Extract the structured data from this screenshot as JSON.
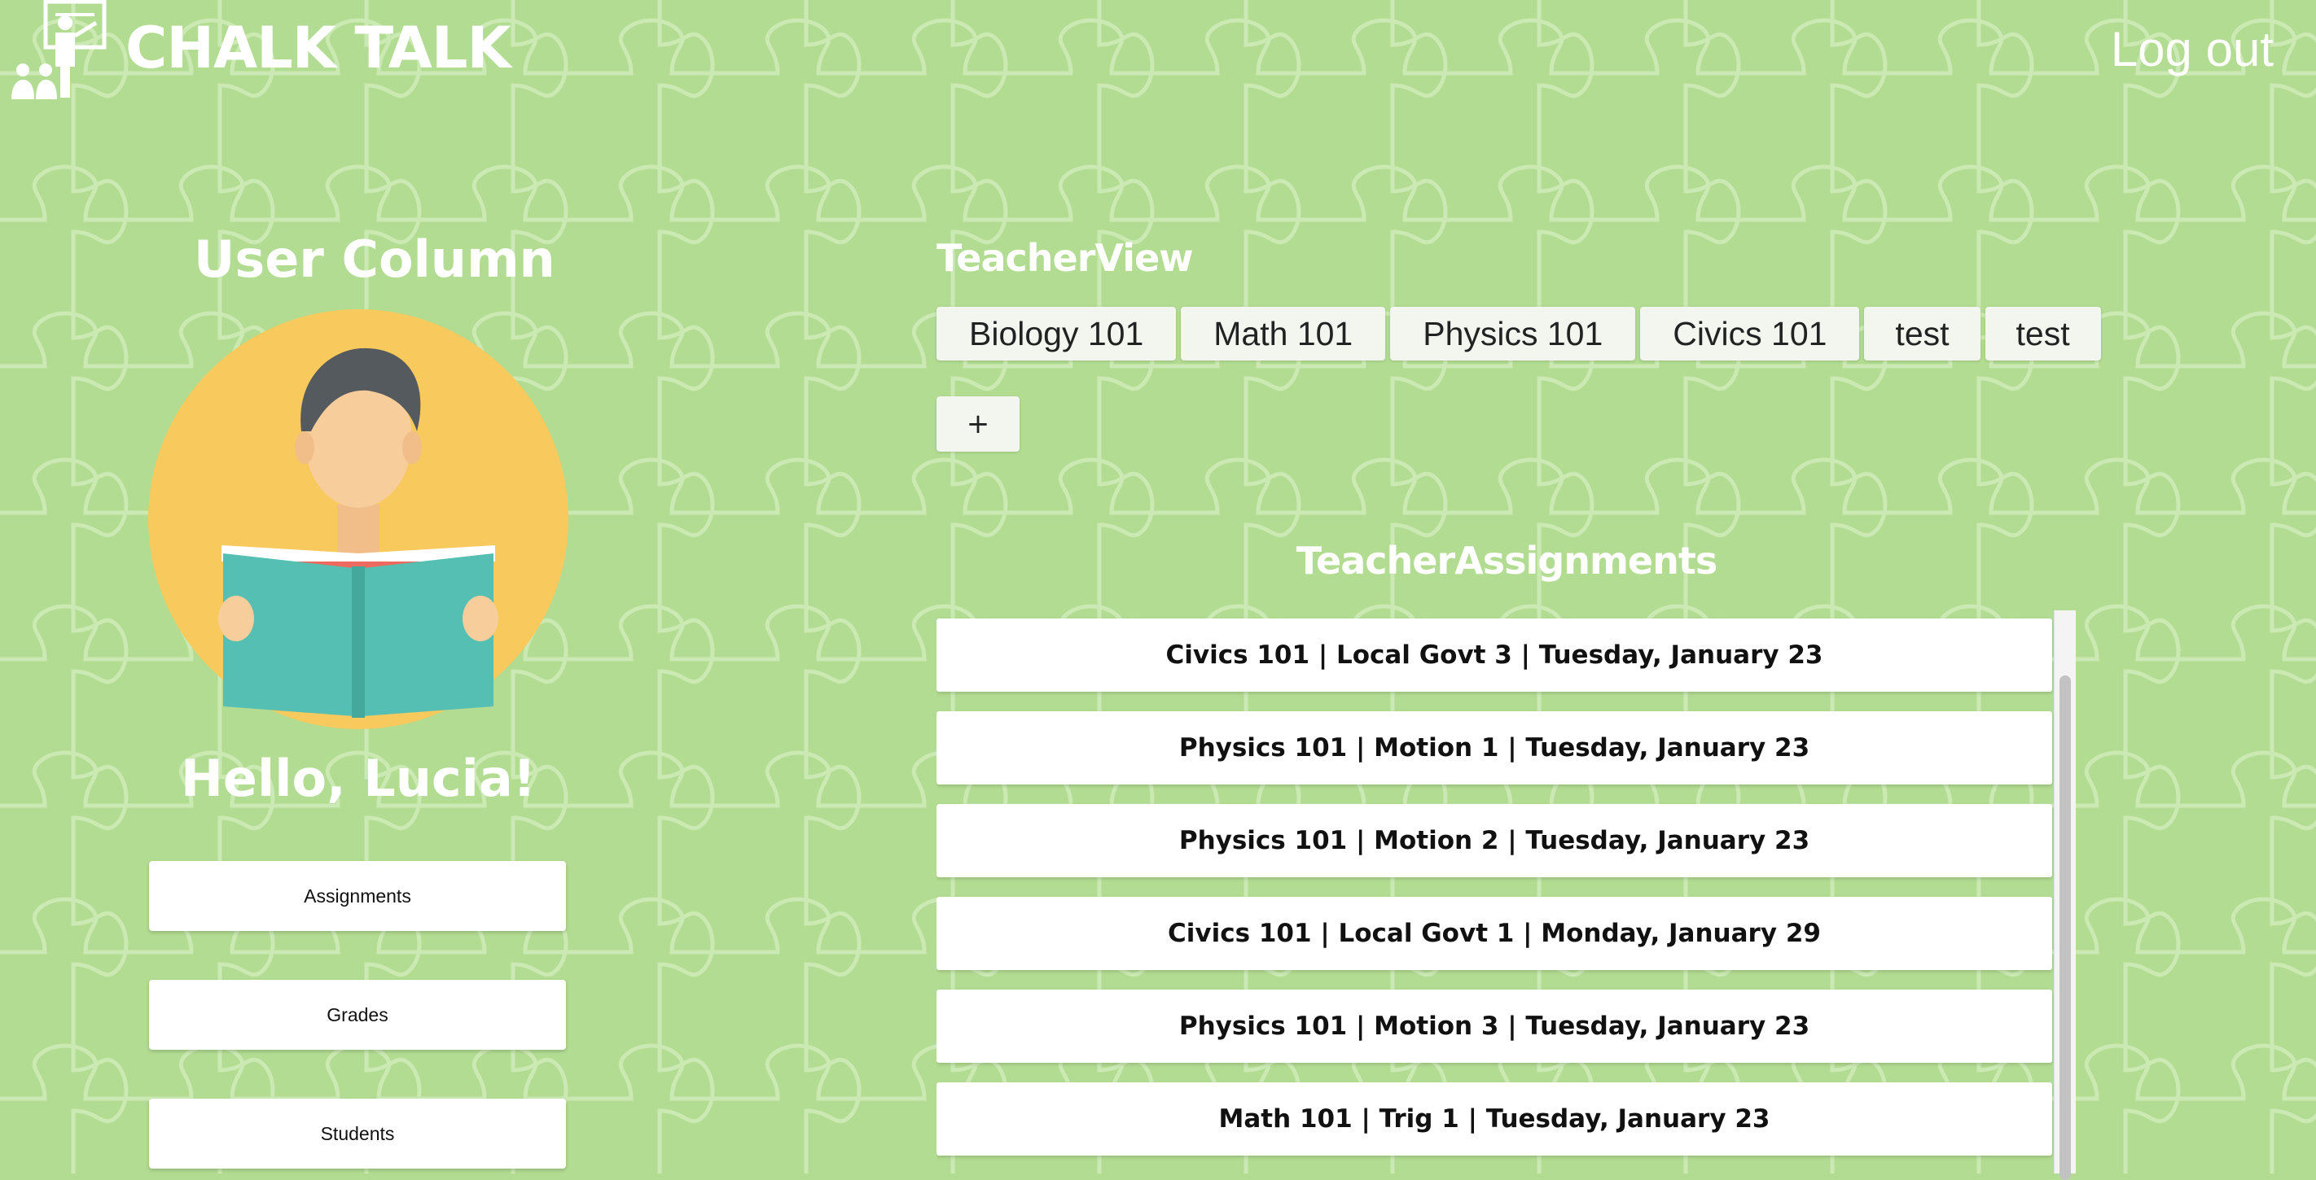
{
  "header": {
    "brand": "CHALK TALK",
    "logout_label": "Log out",
    "logo_icon": "teacher-chalkboard-icon"
  },
  "user_column": {
    "title": "User Column",
    "greeting": "Hello, Lucia!",
    "avatar_icon": "student-reading-avatar",
    "buttons": [
      {
        "label": "Assignments"
      },
      {
        "label": "Grades"
      },
      {
        "label": "Students"
      }
    ]
  },
  "teacher_view": {
    "title": "TeacherView",
    "tabs": [
      {
        "label": "Biology 101"
      },
      {
        "label": "Math 101"
      },
      {
        "label": "Physics 101"
      },
      {
        "label": "Civics 101"
      },
      {
        "label": "test"
      },
      {
        "label": "test"
      }
    ],
    "add_label": "+"
  },
  "assignments": {
    "title": "TeacherAssignments",
    "items": [
      {
        "label": "Civics 101 | Local Govt 3 | Tuesday, January 23"
      },
      {
        "label": "Physics 101 | Motion 1 | Tuesday, January 23"
      },
      {
        "label": "Physics 101 | Motion 2 | Tuesday, January 23"
      },
      {
        "label": "Civics 101 | Local Govt 1 | Monday, January 29"
      },
      {
        "label": "Physics 101 | Motion 3 | Tuesday, January 23"
      },
      {
        "label": "Math 101 | Trig 1 | Tuesday, January 23"
      }
    ]
  },
  "colors": {
    "background": "#b2dc91",
    "pattern_line": "#c9e8b1",
    "text_light": "#ffffff",
    "avatar_circle": "#f8c95c",
    "book": "#56bfb3",
    "shirt": "#ee6a5e",
    "skin": "#f7cd9b",
    "hair": "#555a5f"
  }
}
